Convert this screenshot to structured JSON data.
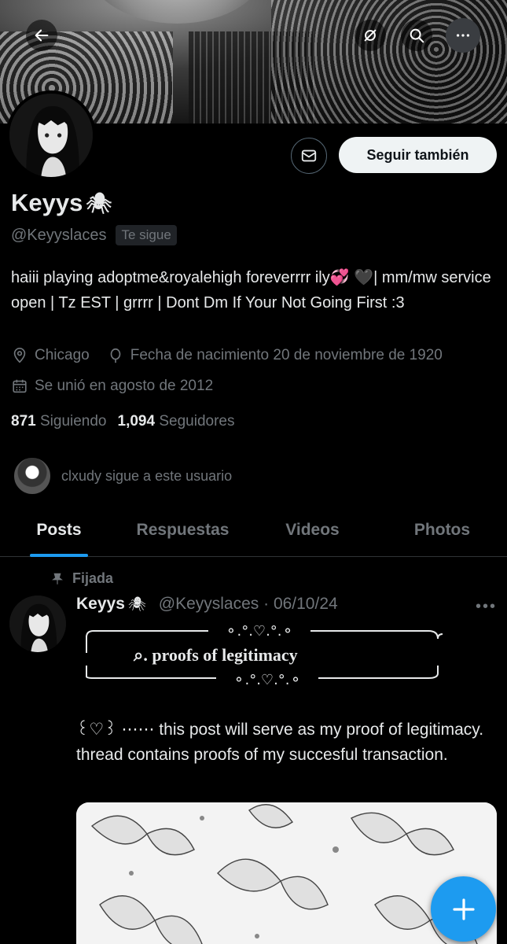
{
  "profile": {
    "name": "Keyys",
    "name_emoji": "🕷",
    "handle": "@Keyyslaces",
    "follows_you": "Te sigue",
    "bio": "haiii playing adoptme&royalehigh foreverrrr ily💞 🖤| mm/mw service open | Tz EST | grrrr | Dont Dm If Your Not Going First :3",
    "location": "Chicago",
    "birthday": "Fecha de nacimiento 20 de noviembre de 1920",
    "joined": "Se unió en agosto de 2012",
    "following_count": "871",
    "following_label": "Siguiendo",
    "followers_count": "1,094",
    "followers_label": "Seguidores",
    "followed_by": "clxudy sigue a este usuario"
  },
  "actions": {
    "follow_label": "Seguir también"
  },
  "tabs": [
    {
      "label": "Posts",
      "active": true
    },
    {
      "label": "Respuestas",
      "active": false
    },
    {
      "label": "Videos",
      "active": false
    },
    {
      "label": "Photos",
      "active": false
    }
  ],
  "post": {
    "pinned_label": "Fijada",
    "author": "Keyys",
    "author_emoji": "🕷",
    "meta": "@Keyyslaces · 06/10/24",
    "frame_top": "⚬.°.♡.°.⚬",
    "frame_title": "⌕. proofs of legitimacy",
    "frame_bottom": "⚬.°.♡.°.⚬",
    "text": "꒰♡꒱ ⋯⋯ this post will serve as my proof of legitimacy. thread contains proofs of my succesful transaction."
  },
  "colors": {
    "accent": "#1d9bf0",
    "muted": "#71767b",
    "text": "#e7e9ea",
    "background": "#000000"
  },
  "icons": [
    "back-arrow-icon",
    "hide-icon",
    "search-icon",
    "more-icon",
    "mail-icon",
    "location-icon",
    "birthday-icon",
    "calendar-icon",
    "pin-icon",
    "plus-icon"
  ]
}
